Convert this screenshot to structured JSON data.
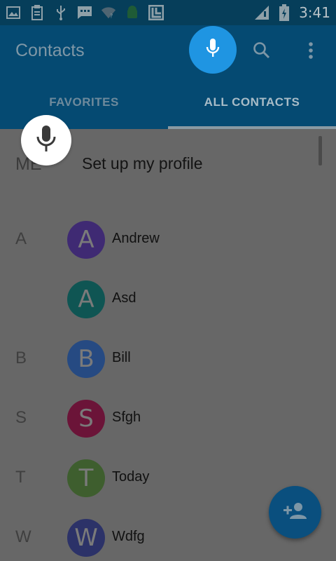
{
  "status_bar": {
    "time": "3:41",
    "left_icons": [
      "image-icon",
      "clipboard-icon",
      "usb-icon",
      "message-icon",
      "wifi-question-icon",
      "android-icon",
      "app-icon"
    ],
    "right_icons": [
      "signal-icon",
      "battery-charging-icon"
    ]
  },
  "toolbar": {
    "title": "Contacts",
    "actions": [
      "mic-icon",
      "search-icon",
      "more-vert-icon"
    ]
  },
  "tabs": [
    {
      "label": "FAVORITES",
      "active": false
    },
    {
      "label": "ALL CONTACTS",
      "active": true
    }
  ],
  "profile": {
    "section_label": "ME",
    "text": "Set up my profile"
  },
  "contacts": [
    {
      "section": "A",
      "initial": "A",
      "name": "Andrew",
      "color": "#3f2a73"
    },
    {
      "section": "",
      "initial": "A",
      "name": "Asd",
      "color": "#0f5553"
    },
    {
      "section": "B",
      "initial": "B",
      "name": "Bill",
      "color": "#264a82"
    },
    {
      "section": "S",
      "initial": "S",
      "name": "Sfgh",
      "color": "#6b1438"
    },
    {
      "section": "T",
      "initial": "T",
      "name": "Today",
      "color": "#3e5e2e"
    },
    {
      "section": "W",
      "initial": "W",
      "name": "Wdfg",
      "color": "#2c3268"
    }
  ],
  "fab": {
    "icon": "person-add-icon"
  },
  "colors": {
    "accent": "#1f95e2",
    "toolbar": "#054a72",
    "status_bar": "#063e5a"
  }
}
